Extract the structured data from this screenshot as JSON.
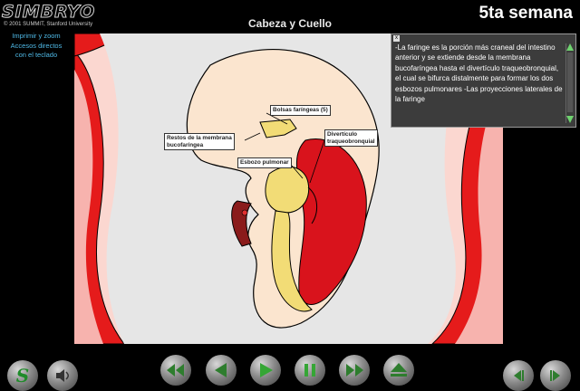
{
  "app": {
    "logo_text": "SIMBRYO",
    "copyright": "© 2001 SUMMIT, Stanford University"
  },
  "side_links": [
    "Imprimir y zoom",
    "Accesos directos",
    "con el teclado"
  ],
  "page_title": "Cabeza y Cuello",
  "week_title": "5ta semana",
  "info_panel": {
    "close_glyph": "x",
    "text": "-La faringe es la porción más craneal del intestino anterior y se extiende desde la membrana bucofaríngea hasta el divertículo traqueobronquial, el cual se bifurca distalmente para formar los dos esbozos pulmonares -Las proyecciones laterales de la faringe"
  },
  "labels": {
    "pouches": "Bolsas faríngeas (5)",
    "membrane_line1": "Restos de la membrana",
    "membrane_line2": "bucofaríngea",
    "diverticulum_line1": "Divertículo",
    "diverticulum_line2": "traqueobronquial",
    "lung_bud": "Esbozo pulmonar"
  },
  "controls": [
    {
      "name": "summit-logo-button",
      "icon": "s-logo-icon"
    },
    {
      "name": "sound-button",
      "icon": "speaker-icon"
    },
    {
      "name": "rewind-button",
      "icon": "rewind-icon"
    },
    {
      "name": "step-back-button",
      "icon": "step-back-icon"
    },
    {
      "name": "play-button",
      "icon": "play-icon"
    },
    {
      "name": "pause-button",
      "icon": "pause-icon"
    },
    {
      "name": "fast-forward-button",
      "icon": "fast-forward-icon"
    },
    {
      "name": "eject-button",
      "icon": "eject-icon"
    },
    {
      "name": "previous-page-button",
      "icon": "previous-icon"
    },
    {
      "name": "next-page-button",
      "icon": "next-icon"
    }
  ],
  "colors": {
    "link": "#4fb9e6",
    "play_green": "#35a635",
    "tissue_red": "#d9131c",
    "endoderm_yellow": "#f2dc76"
  }
}
